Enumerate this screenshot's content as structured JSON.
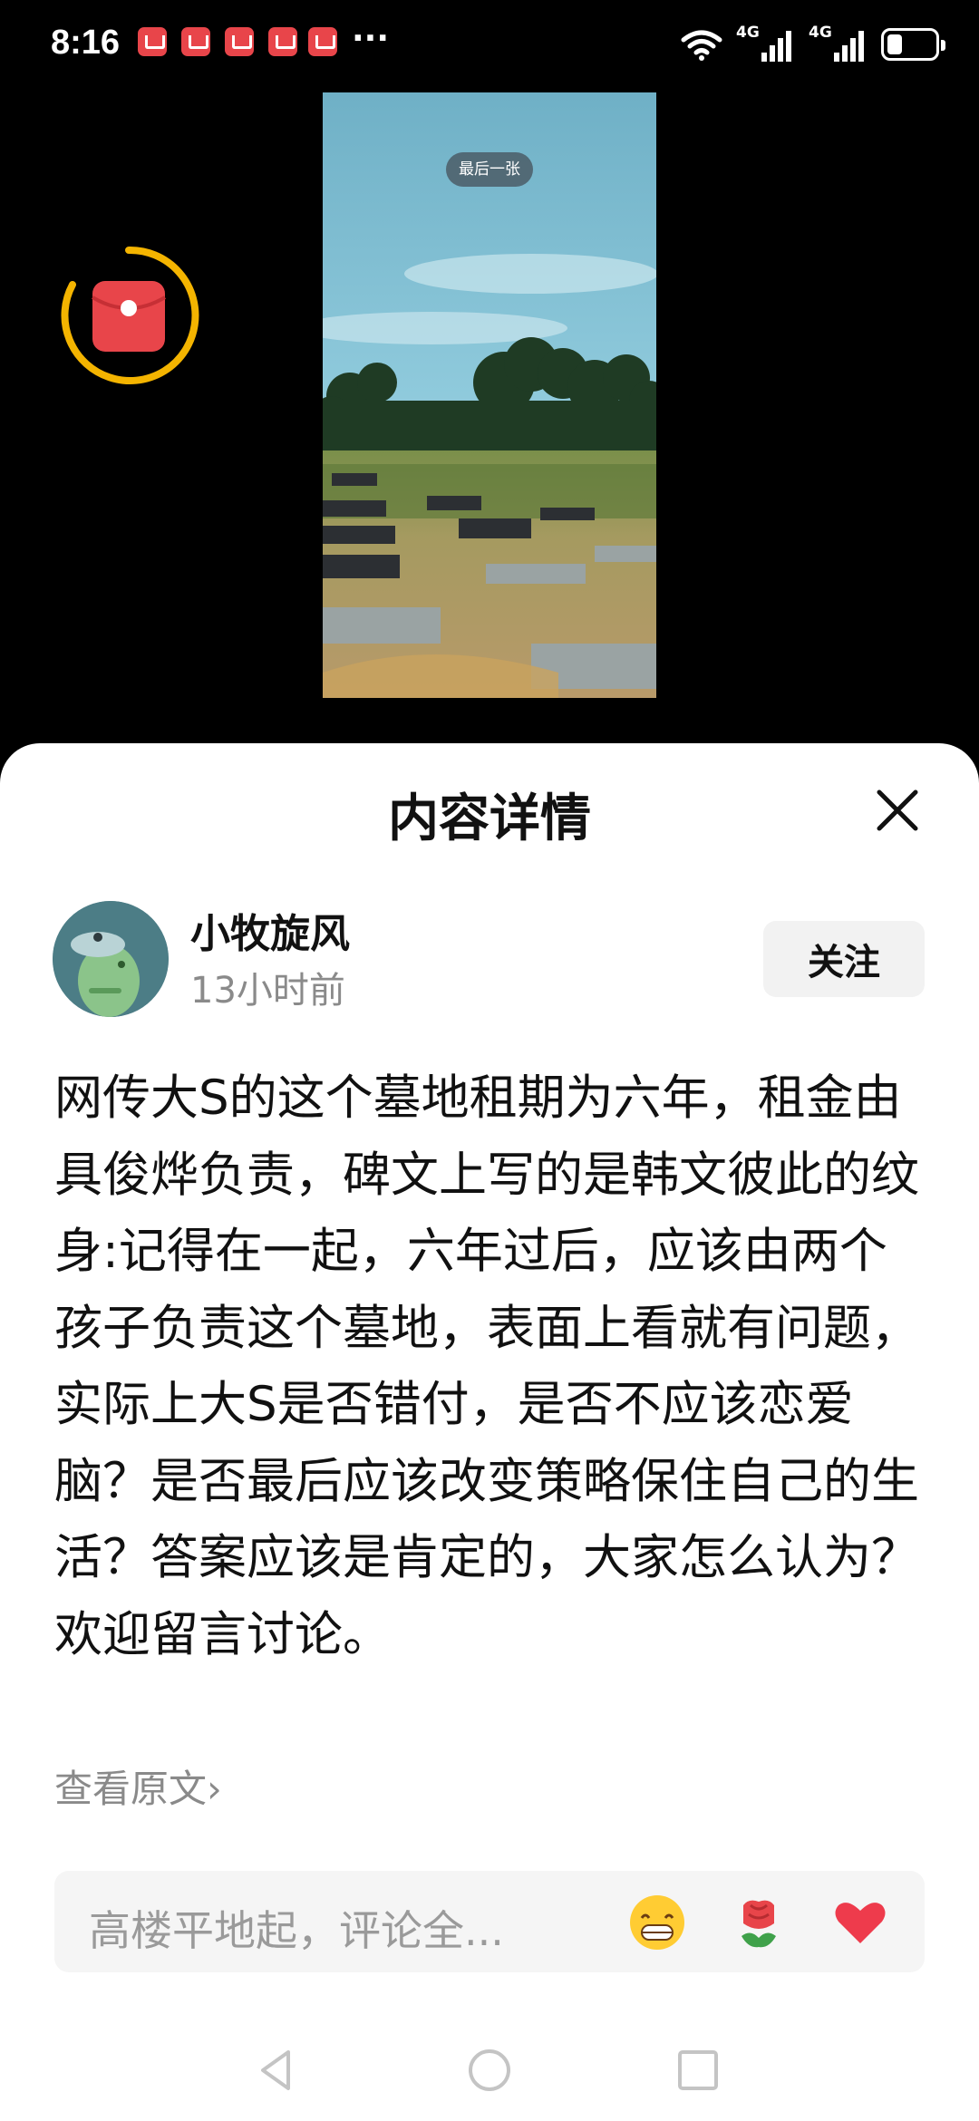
{
  "status_bar": {
    "time": "8:16",
    "more": "···",
    "signal1_label": "4G",
    "signal2_label": "4G"
  },
  "image_viewer": {
    "badge": "最后一张"
  },
  "sheet": {
    "title": "内容详情"
  },
  "author": {
    "name": "小牧旋风",
    "time_ago": "13小时前",
    "follow_label": "关注"
  },
  "post": {
    "text": "网传大S的这个墓地租期为六年，租金由具俊烨负责，碑文上写的是韩文彼此的纹身:记得在一起，六年过后，应该由两个孩子负责这个墓地，表面上看就有问题，实际上大S是否错付，是否不应该恋爱脑？是否最后应该改变策略保住自己的生活？答案应该是肯定的，大家怎么认为？欢迎留言讨论。",
    "view_original": "查看原文›"
  },
  "comment": {
    "placeholder": "高楼平地起，评论全...",
    "emojis": [
      "grin-emoji",
      "rose-emoji",
      "heart-emoji"
    ]
  },
  "colors": {
    "accent_red": "#e8454a",
    "ring_yellow": "#f4b400",
    "gray_text": "#8a8a8a"
  }
}
